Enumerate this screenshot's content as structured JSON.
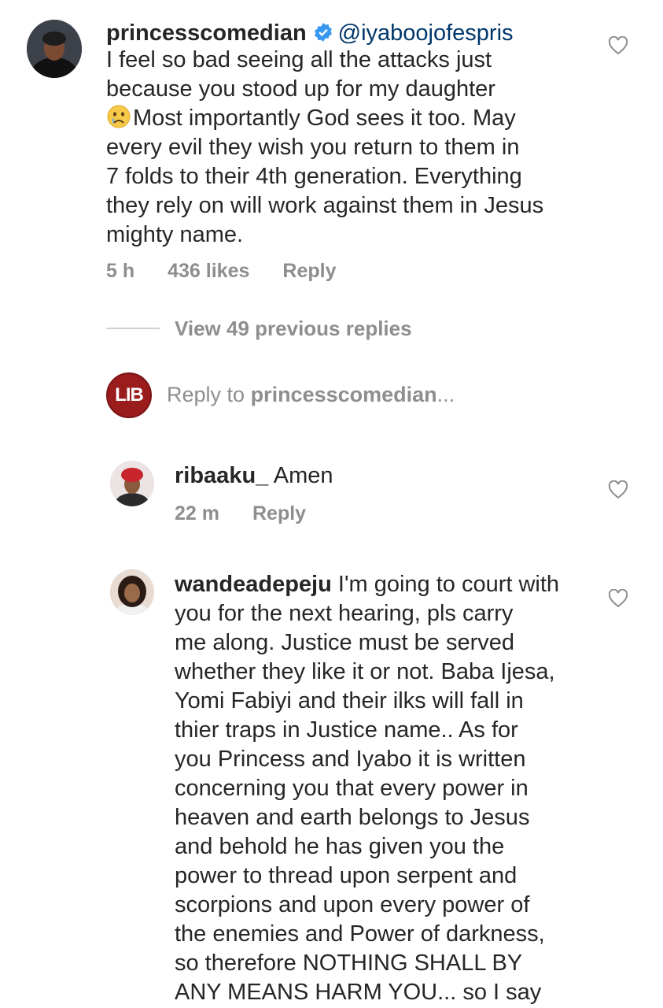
{
  "main_comment": {
    "username": "princesscomedian",
    "mention": "@iyaboojofespris",
    "text_line_1": "I feel so bad seeing all the attacks just",
    "text_line_2": "because you stood up for my daughter",
    "text_line_3": "Most importantly God sees it too. May",
    "text_line_4": "every evil they wish you return to them in",
    "text_line_5": "7 folds to their 4th generation. Everything",
    "text_line_6": "they rely on will work against them in Jesus",
    "text_line_7": "mighty name.",
    "time": "5 h",
    "likes": "436 likes",
    "reply_label": "Reply",
    "emoji": "crying-face-emoji"
  },
  "view_previous": "View 49 previous replies",
  "reply_box": {
    "prefix": "Reply to ",
    "target": "princesscomedian",
    "suffix": "...",
    "avatar_text": "LIB"
  },
  "replies": [
    {
      "username": "ribaaku_",
      "text": "Amen",
      "time": "22 m",
      "reply_label": "Reply"
    },
    {
      "username": "wandeadepeju",
      "first_line": "I'm going to court with",
      "lines": [
        "you for the next hearing, pls carry",
        "me along. Justice must be served",
        "whether they like it or not. Baba Ijesa,",
        "Yomi Fabiyi and their ilks will fall in",
        "thier traps in Justice name.. As for",
        "you Princess and Iyabo it is written",
        "concerning you that every power in",
        "heaven and earth belongs to Jesus",
        "and behold he has given you the",
        "power to thread upon serpent and",
        "scorpions and upon every power of",
        "the enemies and Power of darkness,",
        "so therefore NOTHING SHALL BY",
        "ANY MEANS HARM YOU... so I say"
      ]
    }
  ],
  "colors": {
    "text": "#262626",
    "secondary": "#8e8e8e",
    "mention": "#00376b",
    "verified": "#3897f0",
    "lib_red": "#9b1c1c"
  }
}
